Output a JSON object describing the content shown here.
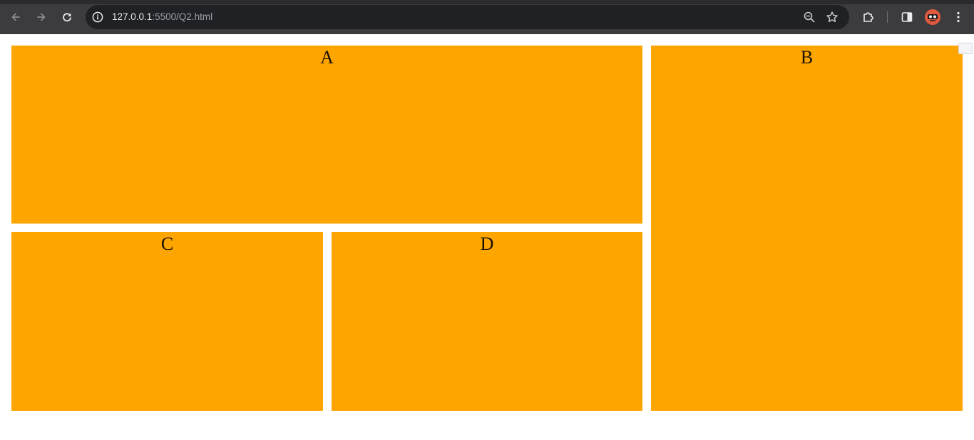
{
  "browser": {
    "url_host": "127.0.0.1",
    "url_rest": ":5500/Q2.html",
    "icons": {
      "back": "arrow-left",
      "forward": "arrow-right",
      "reload": "reload",
      "info": "info-circle",
      "zoom": "magnifier-minus",
      "bookmark": "star",
      "extensions": "puzzle",
      "side_panel": "side-panel",
      "profile": "avatar",
      "menu": "three-dots-vertical"
    },
    "colors": {
      "toolbar_bg": "#3c3c3f",
      "omnibox_bg": "#202124"
    }
  },
  "page": {
    "boxes": {
      "a": "A",
      "b": "B",
      "c": "C",
      "d": "D"
    },
    "colors": {
      "box_fill": "#ffa500",
      "background": "#ffffff"
    }
  }
}
